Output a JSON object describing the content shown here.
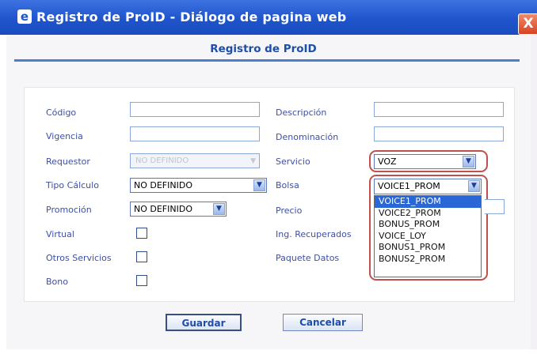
{
  "window": {
    "title": "Registro de ProID - Diálogo de pagina web",
    "close_label": "X"
  },
  "form": {
    "heading": "Registro de ProID",
    "fields": {
      "codigo": {
        "label": "Código",
        "value": ""
      },
      "vigencia": {
        "label": "Vigencia",
        "value": ""
      },
      "requestor": {
        "label": "Requestor",
        "value": "NO DEFINIDO"
      },
      "tipo_calculo": {
        "label": "Tipo Cálculo",
        "value": "NO DEFINIDO"
      },
      "promocion": {
        "label": "Promoción",
        "value": "NO DEFINIDO"
      },
      "virtual": {
        "label": "Virtual",
        "checked": false
      },
      "otros_servicios": {
        "label": "Otros Servicios",
        "checked": false
      },
      "bono": {
        "label": "Bono",
        "checked": false
      },
      "descripcion": {
        "label": "Descripción",
        "value": ""
      },
      "denominacion": {
        "label": "Denominación",
        "value": ""
      },
      "servicio": {
        "label": "Servicio",
        "value": "VOZ"
      },
      "bolsa": {
        "label": "Bolsa",
        "value": "VOICE1_PROM",
        "options": [
          "VOICE1_PROM",
          "VOICE2_PROM",
          "BONUS_PROM",
          "VOICE_LOY",
          "BONUS1_PROM",
          "BONUS2_PROM"
        ],
        "highlighted_index": 0
      },
      "precio": {
        "label": "Precio",
        "value": ""
      },
      "ing_recuperados": {
        "label": "Ing. Recuperados"
      },
      "paquete_datos": {
        "label": "Paquete Datos"
      }
    }
  },
  "buttons": {
    "save": "Guardar",
    "cancel": "Cancelar"
  },
  "icons": {
    "dropdown_arrow": "▼",
    "ie_icon": "e"
  },
  "colors": {
    "titlebar": "#1f54cc",
    "heading": "#1d4ea8",
    "label": "#3e4fa3",
    "highlight_ring": "#c0504d",
    "selected_option": "#2a67d6"
  }
}
